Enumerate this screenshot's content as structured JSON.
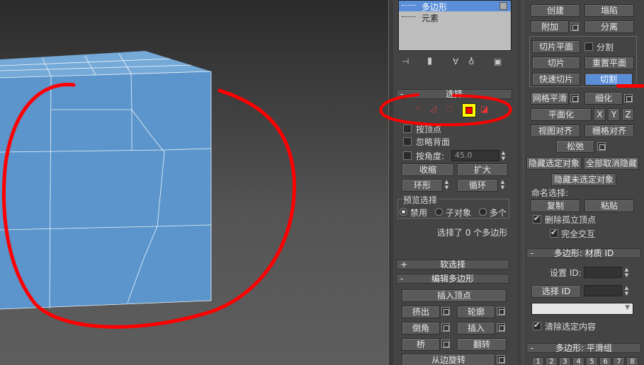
{
  "stack_list": {
    "items": [
      {
        "label": "多边形"
      },
      {
        "label": "元素"
      }
    ]
  },
  "selection": {
    "title": "选择",
    "by_vertex_label": "按顶点",
    "ignore_backfacing_label": "忽略背面",
    "by_angle_label": "按角度:",
    "angle_value": "45.0",
    "shrink_label": "收缩",
    "grow_label": "扩大",
    "ring_label": "环形",
    "loop_label": "循环",
    "preview_title": "预览选择",
    "preview_off": "禁用",
    "preview_subobj": "子对象",
    "preview_multi": "多个",
    "status": "选择了 0 个多边形"
  },
  "soft_selection": {
    "title": "软选择"
  },
  "edit_polygons": {
    "title": "编辑多边形",
    "insert_vertex": "插入顶点",
    "extrude": "挤出",
    "outline": "轮廓",
    "bevel": "倒角",
    "inset": "插入",
    "bridge": "桥",
    "flip": "翻转",
    "hinge": "从边旋转"
  },
  "edit_geometry": {
    "create": "创建",
    "collapse": "塌陷",
    "attach": "附加",
    "detach": "分离",
    "slice_plane": "切片平面",
    "split": "分割",
    "slice": "切片",
    "reset_plane": "重置平面",
    "quickslice": "快速切片",
    "cut": "切割",
    "meshsmooth": "网格平滑",
    "tessellate": "细化",
    "make_planar": "平面化",
    "x": "X",
    "y": "Y",
    "z": "Z",
    "view_align": "视图对齐",
    "grid_align": "栅格对齐",
    "relax": "松弛",
    "hide_selected": "隐藏选定对象",
    "unhide_all": "全部取消隐藏",
    "hide_unselected": "隐藏未选定对象",
    "named_selections": "命名选择:",
    "copy": "复制",
    "paste": "粘贴",
    "delete_isolated": "删除孤立顶点",
    "full_interactivity": "完全交互"
  },
  "material_ids": {
    "title": "多边形: 材质 ID",
    "set_id": "设置 ID:",
    "select_id": "选择 ID",
    "clear_selection": "清除选定内容"
  },
  "smoothing_groups": {
    "title": "多边形: 平滑组",
    "numbers": [
      "1",
      "2",
      "3",
      "4",
      "5",
      "6",
      "7",
      "8"
    ]
  },
  "colors": {
    "highlight": "#5a8ed8",
    "annotation_red": "#ff0000",
    "cube": "#5b95cb",
    "selected_mode_bg": "#ffff00"
  }
}
